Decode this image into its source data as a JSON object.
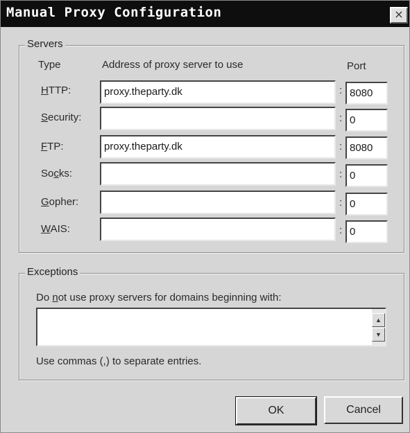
{
  "window": {
    "title": "Manual Proxy Configuration",
    "close_glyph": "×"
  },
  "servers": {
    "group_label": "Servers",
    "headers": {
      "type": "Type",
      "address": "Address of proxy server to use",
      "port": "Port"
    },
    "rows": [
      {
        "pre": "",
        "key": "H",
        "post": "TTP:",
        "address": "proxy.theparty.dk",
        "port": "8080"
      },
      {
        "pre": "",
        "key": "S",
        "post": "ecurity:",
        "address": "",
        "port": "0"
      },
      {
        "pre": "",
        "key": "F",
        "post": "TP:",
        "address": "proxy.theparty.dk",
        "port": "8080"
      },
      {
        "pre": "So",
        "key": "c",
        "post": "ks:",
        "address": "",
        "port": "0"
      },
      {
        "pre": "",
        "key": "G",
        "post": "opher:",
        "address": "",
        "port": "0"
      },
      {
        "pre": "",
        "key": "W",
        "post": "AIS:",
        "address": "",
        "port": "0"
      }
    ],
    "colon": ":"
  },
  "exceptions": {
    "group_label": "Exceptions",
    "prompt_pre": "Do ",
    "prompt_key": "n",
    "prompt_post": "ot use proxy servers for domains beginning with:",
    "value": "",
    "hint": "Use commas (,) to separate entries.",
    "scroll_up_glyph": "▲",
    "scroll_down_glyph": "▼"
  },
  "buttons": {
    "ok": "OK",
    "cancel": "Cancel"
  }
}
